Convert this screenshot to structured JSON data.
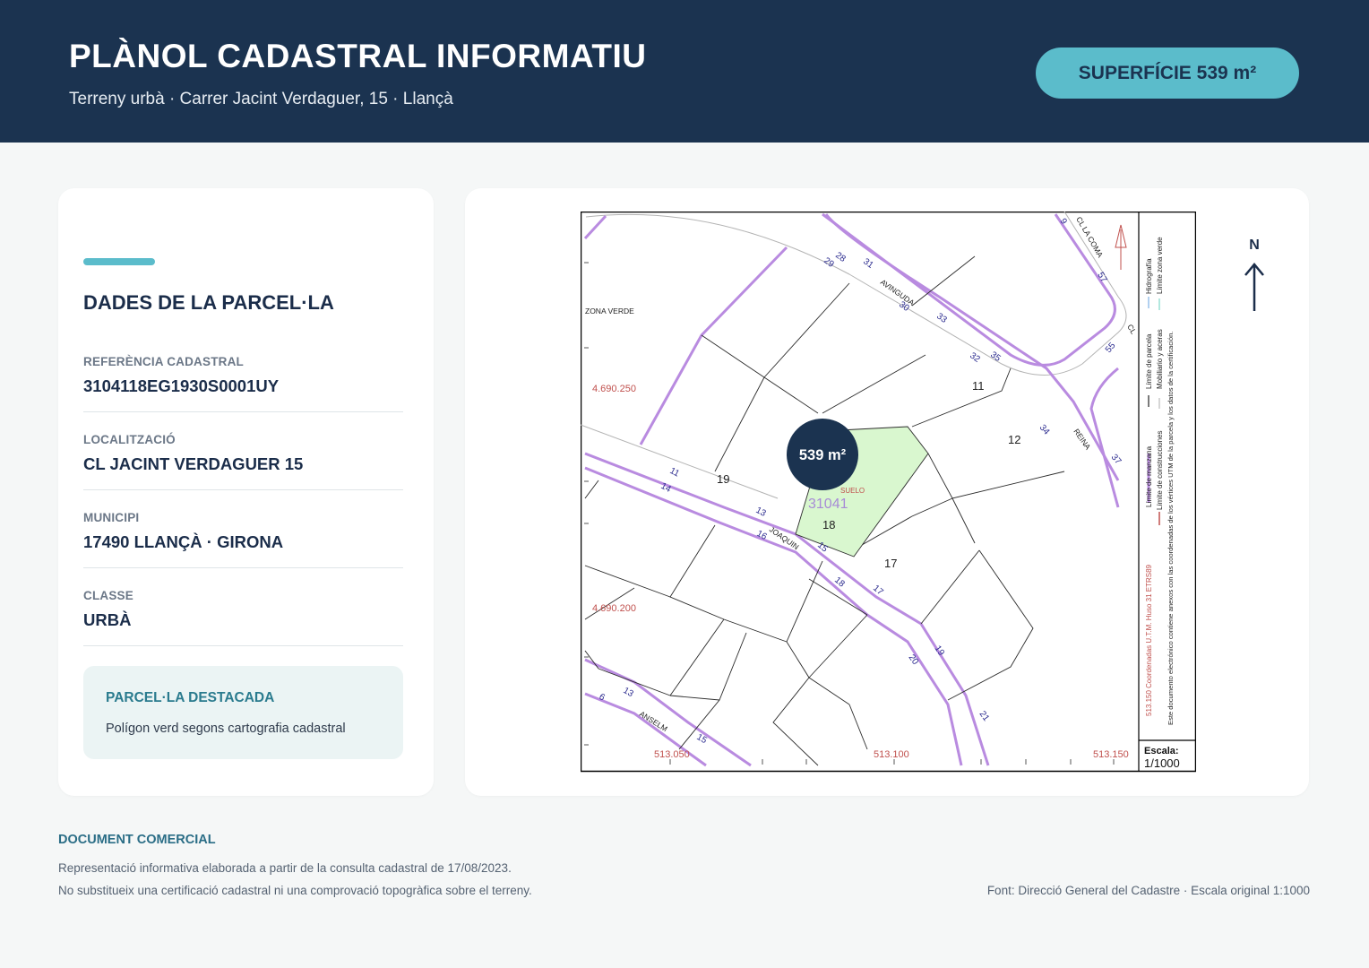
{
  "header": {
    "title": "PLÀNOL CADASTRAL INFORMATIU",
    "subtitle": "Terreny urbà · Carrer Jacint Verdaguer, 15 · Llançà",
    "area_badge": "SUPERFÍCIE 539 m²"
  },
  "parcel_panel": {
    "title": "DADES DE LA PARCEL·LA",
    "fields": [
      {
        "label": "REFERÈNCIA CADASTRAL",
        "value": "3104118EG1930S0001UY"
      },
      {
        "label": "LOCALITZACIÓ",
        "value": "CL JACINT VERDAGUER 15"
      },
      {
        "label": "MUNICIPI",
        "value": "17490 LLANÇÀ · GIRONA"
      },
      {
        "label": "CLASSE",
        "value": "URBÀ"
      }
    ],
    "highlight": {
      "title": "PARCEL·LA DESTACADA",
      "text": "Polígon verd segons cartografia cadastral"
    }
  },
  "map": {
    "area_marker": "539 m²",
    "parcel_id": "31041",
    "parcel_number": "18",
    "suelo_label": "SUELO",
    "zona_verde_label": "ZONA VERDE",
    "street_labels": {
      "avinguda": "AVINGUDA",
      "joaquin": "JOAQUIN",
      "anselm": "ANSELM",
      "reina": "REINA",
      "coma": "CL LA COMA",
      "cl": "CL"
    },
    "block_numbers": [
      "11",
      "12",
      "17",
      "19"
    ],
    "house_numbers": [
      "28",
      "29",
      "31",
      "30",
      "33",
      "32",
      "35",
      "34",
      "37",
      "55",
      "57",
      "11",
      "14",
      "13",
      "16",
      "15",
      "18",
      "17",
      "20",
      "19",
      "21",
      "13",
      "6",
      "15",
      "9"
    ],
    "coord_labels": {
      "y1": "4.690.250",
      "y2": "4.690.200",
      "x1": "513.050",
      "x2": "513.100",
      "x3": "513.150"
    },
    "legend": {
      "manzana": "Límite de manzana",
      "construcciones": "Límite de construcciones",
      "parcela": "Límite de parcela",
      "mobiliario": "Mobiliario y aceras",
      "hidrografia": "Hidrografía",
      "zona_verde": "Límite zona verde",
      "coords": "513.150 Coordenadas U.T.M. Huso 31 ETRS89",
      "note": "Este documento electrónico contiene anexos con las coordenadas de los vértices UTM de la parcela y los datos de la certificación."
    },
    "scale_label": "Escala:",
    "scale_value": "1/1000",
    "north_label": "N",
    "colors": {
      "parcel_fill": "#d9f7cf",
      "parcel_boundary": "#b98be0",
      "coords": "#c0504d",
      "header_bg": "#1b3350",
      "accent": "#5bbccb"
    }
  },
  "footer": {
    "title": "DOCUMENT COMERCIAL",
    "line1": "Representació informativa elaborada a partir de la consulta cadastral de 17/08/2023.",
    "line2": "No substitueix una certificació cadastral ni una comprovació topogràfica sobre el terreny.",
    "source": "Font: Direcció General del Cadastre · Escala original 1:1000"
  }
}
